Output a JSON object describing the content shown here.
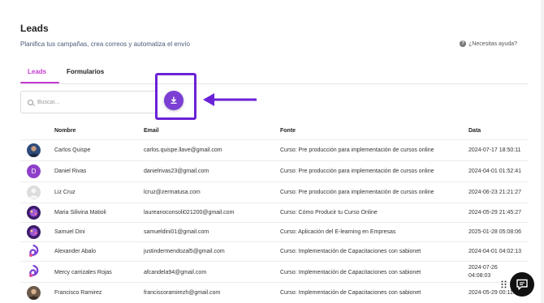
{
  "page": {
    "title": "Leads",
    "subtitle": "Planifica tus campañas, crea correos y automatiza el envío",
    "help": "¿Necesitas ayuda?"
  },
  "tabs": [
    {
      "label": "Leads",
      "active": true
    },
    {
      "label": "Formularios",
      "active": false
    }
  ],
  "search": {
    "placeholder": "Buscar..."
  },
  "colors": {
    "accent": "#c43bd2",
    "download_button": "#7b3fd4",
    "highlight": "#6b22d6"
  },
  "table": {
    "headers": [
      "Nombre",
      "Email",
      "Fonte",
      "Data"
    ],
    "rows": [
      {
        "avatar": "photo-man-dark",
        "name": "Carlos Quispe",
        "email": "carlos.quispe.llave@gmail.com",
        "source": "Curso: Pre producción para implementación de cursos online",
        "date": "2024-07-17 18:50:11"
      },
      {
        "avatar": "letter-D",
        "avatar_letter": "D",
        "name": "Daniel Rivas",
        "email": "danielrivas23@gmail.com",
        "source": "Curso: Pre producción para implementación de cursos online",
        "date": "2024-04-01 01:52:41"
      },
      {
        "avatar": "default-user",
        "name": "Liz Cruz",
        "email": "lcruz@zermatusa.com",
        "source": "Curso: Pre producción para implementación de cursos online",
        "date": "2024-06-23 21:21:27"
      },
      {
        "avatar": "purple-logo",
        "name": "Maria Silivina Matioli",
        "email": "laureanoconsoli021200@gmail.com",
        "source": "Curso: Cómo Producir tu Curso Online",
        "date": "2024-05-29 21:45:27"
      },
      {
        "avatar": "purple-logo",
        "name": "Samuel Dini",
        "email": "samueldini01@gmail.com",
        "source": "Curso: Aplicación del E-learning en Empresas",
        "date": "2025-01-28 05:08:06"
      },
      {
        "avatar": "purple-swirl",
        "name": "Alexander Abalo",
        "email": "justindermendozal5@gmail.com",
        "source": "Curso: Implementación de Capacitaciones con sabionet",
        "date": "2024-04-01 04:02:13"
      },
      {
        "avatar": "purple-swirl",
        "name": "Mercy carrizales Rojas",
        "email": "afcandela94@gmail.com",
        "source": "Curso: Implementación de Capacitaciones con sabionet",
        "date_line1": "2024-07-26",
        "date_line2": "04:08:03"
      },
      {
        "avatar": "photo-man-light",
        "name": "Francisco Ramirez",
        "email": "franciscoramirezh@gmail.com",
        "source": "Curso: Implementación de Capacitaciones con sabionet",
        "date": "2024-05-29 00:11:20"
      }
    ]
  }
}
